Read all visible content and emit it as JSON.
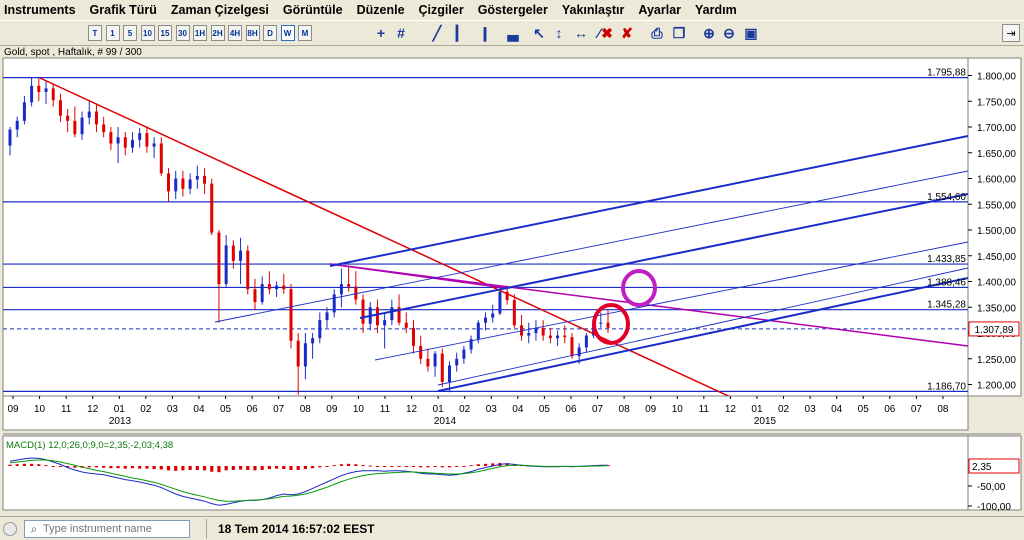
{
  "menu": [
    "Instruments",
    "Grafik Türü",
    "Zaman Çizelgesi",
    "Görüntüle",
    "Düzenle",
    "Çizgiler",
    "Göstergeler",
    "Yakınlaştır",
    "Ayarlar",
    "Yardım"
  ],
  "toolbar": {
    "timeframes": [
      "T",
      "1",
      "5",
      "10",
      "15",
      "30",
      "1H",
      "2H",
      "4H",
      "8H",
      "D",
      "W",
      "M"
    ],
    "active_timeframe": "W",
    "tool_icons": [
      "crosshair-icon",
      "grid-icon",
      "line-chart-icon",
      "bar-chart-icon",
      "candle-chart-icon",
      "area-chart-icon",
      "cursor-tool-icon",
      "pan-tool-icon",
      "measure-icon",
      "draw-line-icon",
      "delete-icon",
      "delete-all-icon",
      "print-icon",
      "copy-icon",
      "zoom-in-icon",
      "zoom-out-icon",
      "zoom-fit-icon"
    ],
    "pin_icon": "pin-icon"
  },
  "chart_header": "Gold, spot , Haftalık, # 99 / 300",
  "chart_data": {
    "type": "candlestick",
    "instrument": "Gold, spot",
    "timeframe": "Haftalık",
    "ylim": [
      1180,
      1810
    ],
    "yticks": [
      "1.800,00",
      "1.750,00",
      "1.700,00",
      "1.650,00",
      "1.600,00",
      "1.550,00",
      "1.500,00",
      "1.450,00",
      "1.400,00",
      "1.350,00",
      "1.300,00",
      "1.250,00",
      "1.200,00"
    ],
    "xtick_labels": [
      "09",
      "10",
      "11",
      "12",
      "01",
      "02",
      "03",
      "04",
      "05",
      "06",
      "07",
      "08",
      "09",
      "10",
      "11",
      "12",
      "01",
      "02",
      "03",
      "04",
      "05",
      "06",
      "07",
      "08",
      "09",
      "10",
      "11",
      "12",
      "01",
      "02",
      "03",
      "04",
      "05",
      "06",
      "07",
      "08"
    ],
    "year_labels": [
      "2013",
      "2014",
      "2015"
    ],
    "horizontal_levels": [
      {
        "value": 1795.88,
        "label": "1.795,88"
      },
      {
        "value": 1554.6,
        "label": "1.554,60"
      },
      {
        "value": 1433.85,
        "label": "1.433,85"
      },
      {
        "value": 1388.46,
        "label": "1.388,46"
      },
      {
        "value": 1345.28,
        "label": "1.345,28"
      },
      {
        "value": 1186.7,
        "label": "1.186,70"
      }
    ],
    "current_price": {
      "value": 1307.89,
      "label": "1.307,89"
    },
    "colors": {
      "up": "#1a2cc8",
      "down": "#e00000",
      "channel": "#1a2cc8",
      "trend": "#e00000",
      "pitchfork_median": "#b000b0",
      "circle_red": "#e0002a",
      "circle_magenta": "#c020c0",
      "current_line": "#1a2cc8"
    },
    "candles": [
      [
        1664,
        1700,
        1645,
        1695
      ],
      [
        1695,
        1720,
        1680,
        1712
      ],
      [
        1712,
        1760,
        1705,
        1748
      ],
      [
        1748,
        1795,
        1740,
        1780
      ],
      [
        1780,
        1795,
        1750,
        1768
      ],
      [
        1768,
        1790,
        1745,
        1775
      ],
      [
        1775,
        1785,
        1740,
        1752
      ],
      [
        1752,
        1765,
        1710,
        1722
      ],
      [
        1722,
        1735,
        1690,
        1712
      ],
      [
        1712,
        1740,
        1680,
        1686
      ],
      [
        1686,
        1730,
        1675,
        1718
      ],
      [
        1718,
        1750,
        1705,
        1730
      ],
      [
        1730,
        1745,
        1690,
        1705
      ],
      [
        1705,
        1720,
        1680,
        1690
      ],
      [
        1690,
        1700,
        1655,
        1668
      ],
      [
        1668,
        1700,
        1630,
        1680
      ],
      [
        1680,
        1690,
        1645,
        1660
      ],
      [
        1660,
        1690,
        1650,
        1675
      ],
      [
        1675,
        1698,
        1660,
        1688
      ],
      [
        1688,
        1700,
        1650,
        1662
      ],
      [
        1662,
        1680,
        1640,
        1668
      ],
      [
        1668,
        1680,
        1605,
        1610
      ],
      [
        1610,
        1620,
        1555,
        1575
      ],
      [
        1575,
        1615,
        1560,
        1600
      ],
      [
        1600,
        1615,
        1565,
        1580
      ],
      [
        1580,
        1610,
        1570,
        1598
      ],
      [
        1598,
        1625,
        1580,
        1605
      ],
      [
        1605,
        1620,
        1570,
        1590
      ],
      [
        1590,
        1600,
        1490,
        1495
      ],
      [
        1495,
        1500,
        1320,
        1395
      ],
      [
        1395,
        1490,
        1390,
        1470
      ],
      [
        1470,
        1480,
        1425,
        1440
      ],
      [
        1440,
        1485,
        1395,
        1460
      ],
      [
        1460,
        1470,
        1375,
        1385
      ],
      [
        1385,
        1405,
        1345,
        1360
      ],
      [
        1360,
        1410,
        1355,
        1395
      ],
      [
        1395,
        1420,
        1375,
        1385
      ],
      [
        1385,
        1400,
        1370,
        1392
      ],
      [
        1392,
        1415,
        1376,
        1385
      ],
      [
        1385,
        1395,
        1270,
        1285
      ],
      [
        1285,
        1300,
        1180,
        1235
      ],
      [
        1235,
        1300,
        1210,
        1280
      ],
      [
        1280,
        1300,
        1250,
        1290
      ],
      [
        1290,
        1340,
        1280,
        1325
      ],
      [
        1325,
        1350,
        1310,
        1340
      ],
      [
        1340,
        1385,
        1330,
        1375
      ],
      [
        1375,
        1425,
        1350,
        1395
      ],
      [
        1395,
        1430,
        1380,
        1390
      ],
      [
        1390,
        1420,
        1355,
        1365
      ],
      [
        1365,
        1375,
        1300,
        1318
      ],
      [
        1318,
        1360,
        1305,
        1350
      ],
      [
        1350,
        1365,
        1300,
        1315
      ],
      [
        1315,
        1340,
        1270,
        1325
      ],
      [
        1325,
        1365,
        1315,
        1350
      ],
      [
        1350,
        1375,
        1315,
        1320
      ],
      [
        1320,
        1340,
        1300,
        1310
      ],
      [
        1310,
        1325,
        1260,
        1275
      ],
      [
        1275,
        1295,
        1240,
        1250
      ],
      [
        1250,
        1270,
        1225,
        1235
      ],
      [
        1235,
        1265,
        1215,
        1260
      ],
      [
        1260,
        1270,
        1195,
        1205
      ],
      [
        1205,
        1245,
        1185,
        1237
      ],
      [
        1237,
        1262,
        1225,
        1250
      ],
      [
        1250,
        1275,
        1240,
        1268
      ],
      [
        1268,
        1295,
        1260,
        1288
      ],
      [
        1288,
        1325,
        1280,
        1320
      ],
      [
        1320,
        1340,
        1305,
        1330
      ],
      [
        1330,
        1355,
        1320,
        1338
      ],
      [
        1338,
        1390,
        1335,
        1380
      ],
      [
        1380,
        1392,
        1355,
        1364
      ],
      [
        1364,
        1375,
        1310,
        1315
      ],
      [
        1315,
        1335,
        1285,
        1295
      ],
      [
        1295,
        1320,
        1280,
        1300
      ],
      [
        1300,
        1325,
        1285,
        1310
      ],
      [
        1310,
        1325,
        1285,
        1295
      ],
      [
        1295,
        1310,
        1280,
        1290
      ],
      [
        1290,
        1305,
        1275,
        1295
      ],
      [
        1295,
        1315,
        1280,
        1292
      ],
      [
        1292,
        1300,
        1250,
        1255
      ],
      [
        1255,
        1280,
        1240,
        1272
      ],
      [
        1272,
        1300,
        1262,
        1295
      ],
      [
        1295,
        1330,
        1290,
        1318
      ],
      [
        1318,
        1340,
        1310,
        1320
      ],
      [
        1320,
        1345,
        1300,
        1310
      ]
    ],
    "macd": {
      "label": "MACD(1) 12,0;26,0;9,0=2,35;-2,03;4,38",
      "yticks": [
        "-50,00",
        "-100,00"
      ],
      "current_label": "2,35",
      "ylim": [
        -110,
        20
      ],
      "histogram": [
        3,
        4,
        5,
        5,
        4,
        2,
        0,
        -2,
        -3,
        -4,
        -4,
        -3,
        -3,
        -4,
        -5,
        -5,
        -6,
        -5,
        -6,
        -6,
        -7,
        -8,
        -10,
        -11,
        -10,
        -9,
        -9,
        -10,
        -13,
        -14,
        -10,
        -9,
        -8,
        -9,
        -10,
        -9,
        -7,
        -6,
        -7,
        -9,
        -9,
        -7,
        -5,
        -3,
        -1,
        2,
        4,
        5,
        4,
        2,
        1,
        0,
        -1,
        0,
        0,
        -1,
        -2,
        -3,
        -3,
        -2,
        -3,
        -3,
        -2,
        0,
        2,
        4,
        5,
        6,
        7,
        6,
        4,
        2,
        1,
        1,
        0,
        0,
        0,
        0,
        -1,
        0,
        1,
        2,
        2,
        2
      ],
      "macd_line": [
        12,
        15,
        18,
        20,
        19,
        16,
        10,
        4,
        -4,
        -10,
        -15,
        -18,
        -20,
        -22,
        -26,
        -30,
        -34,
        -37,
        -40,
        -44,
        -48,
        -54,
        -62,
        -70,
        -76,
        -80,
        -84,
        -88,
        -94,
        -98,
        -96,
        -92,
        -88,
        -86,
        -86,
        -84,
        -80,
        -74,
        -70,
        -72,
        -70,
        -64,
        -56,
        -48,
        -40,
        -32,
        -24,
        -18,
        -14,
        -12,
        -12,
        -12,
        -13,
        -12,
        -12,
        -13,
        -15,
        -18,
        -20,
        -20,
        -22,
        -23,
        -22,
        -18,
        -14,
        -8,
        -4,
        0,
        4,
        6,
        4,
        2,
        0,
        -1,
        -2,
        -2,
        -2,
        -1,
        -2,
        -1,
        0,
        1,
        2,
        2
      ],
      "signal_line": [
        8,
        10,
        12,
        14,
        15,
        15,
        13,
        10,
        6,
        2,
        -3,
        -7,
        -11,
        -14,
        -18,
        -22,
        -26,
        -30,
        -33,
        -37,
        -41,
        -46,
        -52,
        -58,
        -64,
        -69,
        -73,
        -77,
        -82,
        -86,
        -88,
        -88,
        -87,
        -86,
        -85,
        -84,
        -82,
        -79,
        -76,
        -75,
        -73,
        -70,
        -65,
        -59,
        -53,
        -46,
        -39,
        -33,
        -28,
        -24,
        -21,
        -19,
        -18,
        -17,
        -16,
        -15,
        -15,
        -16,
        -17,
        -18,
        -19,
        -20,
        -20,
        -19,
        -17,
        -14,
        -10,
        -6,
        -2,
        1,
        2,
        2,
        1,
        0,
        -1,
        -1,
        -1,
        -1,
        -1,
        -1,
        -1,
        0,
        0,
        1
      ]
    }
  },
  "statusbar": {
    "search_placeholder": "Type instrument name",
    "datetime": "18 Tem 2014 16:57:02 EEST"
  }
}
